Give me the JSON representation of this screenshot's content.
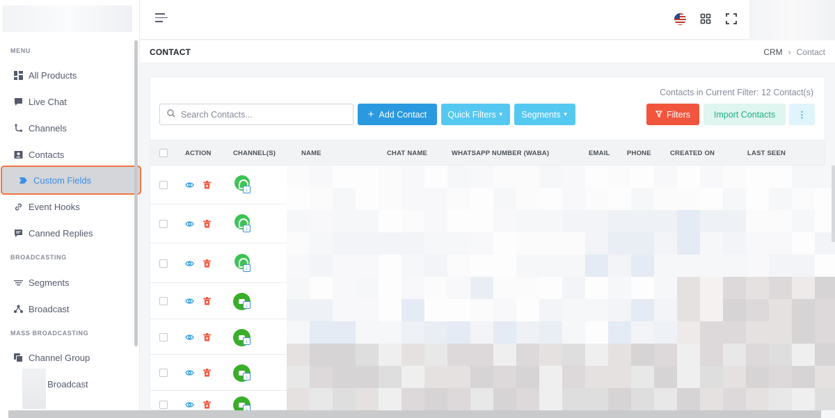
{
  "sidebar": {
    "sections": {
      "menu": "MENU",
      "broadcasting": "BROADCASTING",
      "mass_broadcasting": "MASS BROADCASTING"
    },
    "items": [
      {
        "label": "All Products",
        "icon": "grid-icon"
      },
      {
        "label": "Live Chat",
        "icon": "chat-icon"
      },
      {
        "label": "Channels",
        "icon": "channels-icon"
      },
      {
        "label": "Contacts",
        "icon": "contact-card-icon"
      },
      {
        "label": "Custom Fields",
        "icon": "tag-icon",
        "active": true
      },
      {
        "label": "Event Hooks",
        "icon": "link-icon"
      },
      {
        "label": "Canned Replies",
        "icon": "message-icon"
      },
      {
        "label": "Segments",
        "icon": "filter-lines-icon"
      },
      {
        "label": "Broadcast",
        "icon": "broadcast-icon"
      },
      {
        "label": "Channel Group",
        "icon": "copy-icon"
      },
      {
        "label": "s Broadcast",
        "icon": ""
      }
    ]
  },
  "topbar": {
    "icons": [
      "menu-icon",
      "us-flag-icon",
      "apps-grid-icon",
      "fullscreen-icon"
    ]
  },
  "page": {
    "title": "CONTACT",
    "breadcrumb": {
      "parent": "CRM",
      "separator": "›",
      "current": "Contact"
    }
  },
  "toolbar": {
    "filter_count": "Contacts in Current Filter: 12 Contact(s)",
    "search_placeholder": "Search Contacts...",
    "add_contact": "Add Contact",
    "quick_filters": "Quick Filters",
    "segments": "Segments",
    "filters": "Filters",
    "import_contacts": "Import Contacts",
    "more": "⋮"
  },
  "table": {
    "headers": {
      "action": "ACTION",
      "channels": "CHANNEL(S)",
      "name": "NAME",
      "chat_name": "CHAT NAME",
      "whatsapp": "WHATSAPP NUMBER (WABA)",
      "email": "EMAIL",
      "phone": "PHONE",
      "created_on": "CREATED ON",
      "last_seen": "LAST SEEN"
    },
    "rows": [
      {
        "channel": "whatsapp"
      },
      {
        "channel": "whatsapp"
      },
      {
        "channel": "whatsapp"
      },
      {
        "channel": "bot"
      },
      {
        "channel": "bot"
      },
      {
        "channel": "bot"
      },
      {
        "channel": "bot"
      }
    ]
  },
  "colors": {
    "primary": "#2a99e0",
    "info": "#55c8f2",
    "danger": "#f2553d",
    "success_soft": "#dff5ef",
    "active_outline": "#f0743e",
    "whatsapp_green": "#3dc455"
  }
}
